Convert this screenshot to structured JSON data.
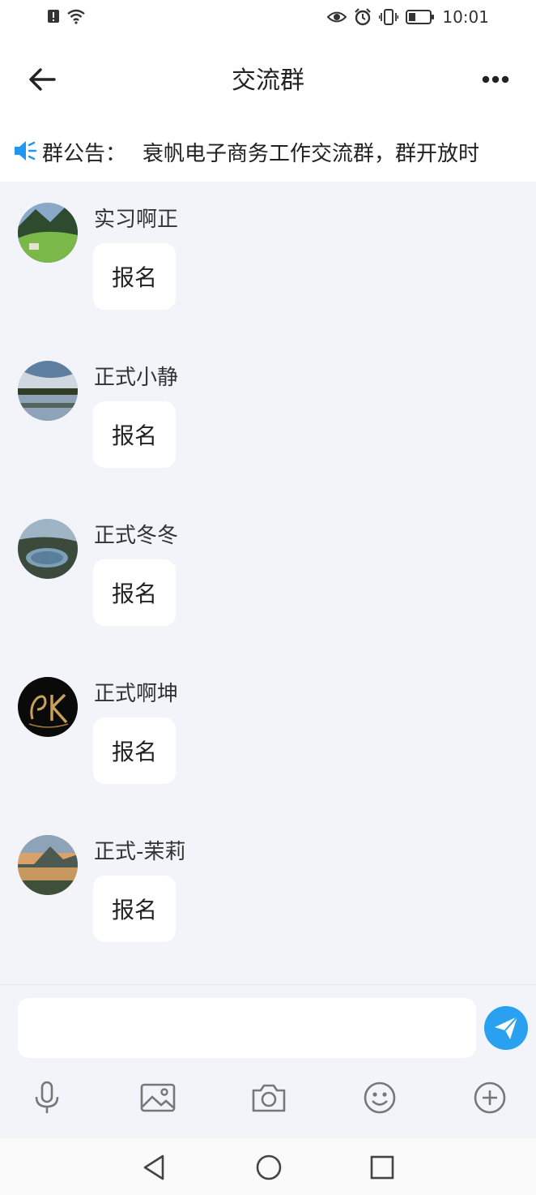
{
  "status_bar": {
    "time": "10:01",
    "left_icons": [
      "alert-icon",
      "wifi-icon"
    ],
    "right_icons": [
      "eye-icon",
      "alarm-icon",
      "vibrate-icon",
      "battery-icon"
    ]
  },
  "header": {
    "title": "交流群"
  },
  "notice": {
    "label": "群公告：",
    "text": "衰帆电子商务工作交流群，群开放时"
  },
  "messages": [
    {
      "sender": "实习啊正",
      "text": "报名"
    },
    {
      "sender": "正式小静",
      "text": "报名"
    },
    {
      "sender": "正式冬冬",
      "text": "报名"
    },
    {
      "sender": "正式啊坤",
      "text": "报名"
    },
    {
      "sender": "正式-茉莉",
      "text": "报名"
    }
  ],
  "input": {
    "value": "",
    "placeholder": ""
  },
  "toolbar": [
    "microphone-icon",
    "image-icon",
    "camera-icon",
    "emoji-icon",
    "plus-icon"
  ],
  "colors": {
    "accent": "#2aa1f0",
    "chat_bg": "#f3f4f9",
    "bubble_bg": "#ffffff"
  }
}
